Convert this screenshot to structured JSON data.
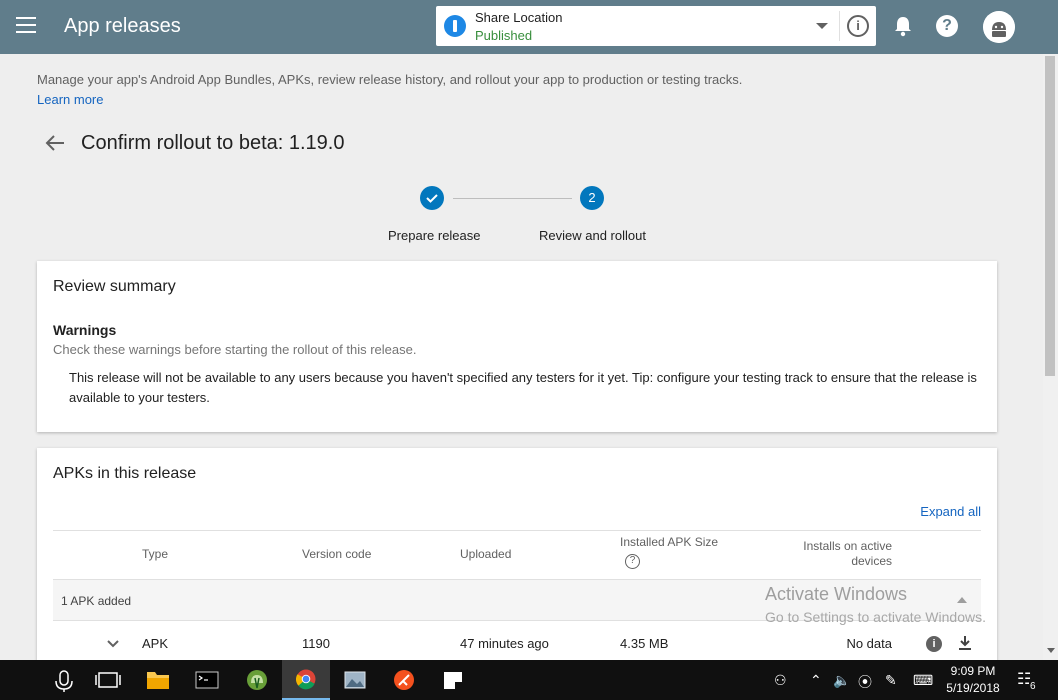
{
  "header": {
    "title": "App releases",
    "app_name": "Share Location",
    "app_status": "Published",
    "info_glyph": "i",
    "help_glyph": "?"
  },
  "intro": {
    "description": "Manage your app's Android App Bundles, APKs, review release history, and rollout your app to production or testing tracks.",
    "learn_more": "Learn more"
  },
  "page": {
    "title": "Confirm rollout to beta: 1.19.0"
  },
  "stepper": {
    "steps": [
      {
        "label": "Prepare release",
        "state": "complete"
      },
      {
        "label": "Review and rollout",
        "number": "2",
        "state": "active"
      }
    ]
  },
  "review": {
    "title": "Review summary",
    "warnings_title": "Warnings",
    "warnings_subtitle": "Check these warnings before starting the rollout of this release.",
    "warning_text": "This release will not be available to any users because you haven't specified any testers for it yet. Tip: configure your testing track to ensure that the release is available to your testers."
  },
  "apks": {
    "title": "APKs in this release",
    "expand_all": "Expand all",
    "columns": [
      "Type",
      "Version code",
      "Uploaded",
      "Installed APK Size",
      "Installs on active devices"
    ],
    "group_label": "1 APK added",
    "rows": [
      {
        "type": "APK",
        "version_code": "1190",
        "uploaded": "47 minutes ago",
        "size": "4.35 MB",
        "installs": "No data"
      }
    ]
  },
  "watermark": {
    "title": "Activate Windows",
    "subtitle": "Go to Settings to activate Windows."
  },
  "taskbar": {
    "time": "9:09 PM",
    "date": "5/19/2018",
    "notifications": "6",
    "icons": [
      "microphone-icon",
      "task-view-icon",
      "file-explorer-icon",
      "terminal-icon",
      "android-studio-icon",
      "chrome-icon",
      "photos-icon",
      "git-icon",
      "sticky-notes-icon"
    ]
  },
  "colors": {
    "topbar": "#607d8b",
    "accent": "#0277bd",
    "link": "#1565c0",
    "published": "#388e3c"
  }
}
